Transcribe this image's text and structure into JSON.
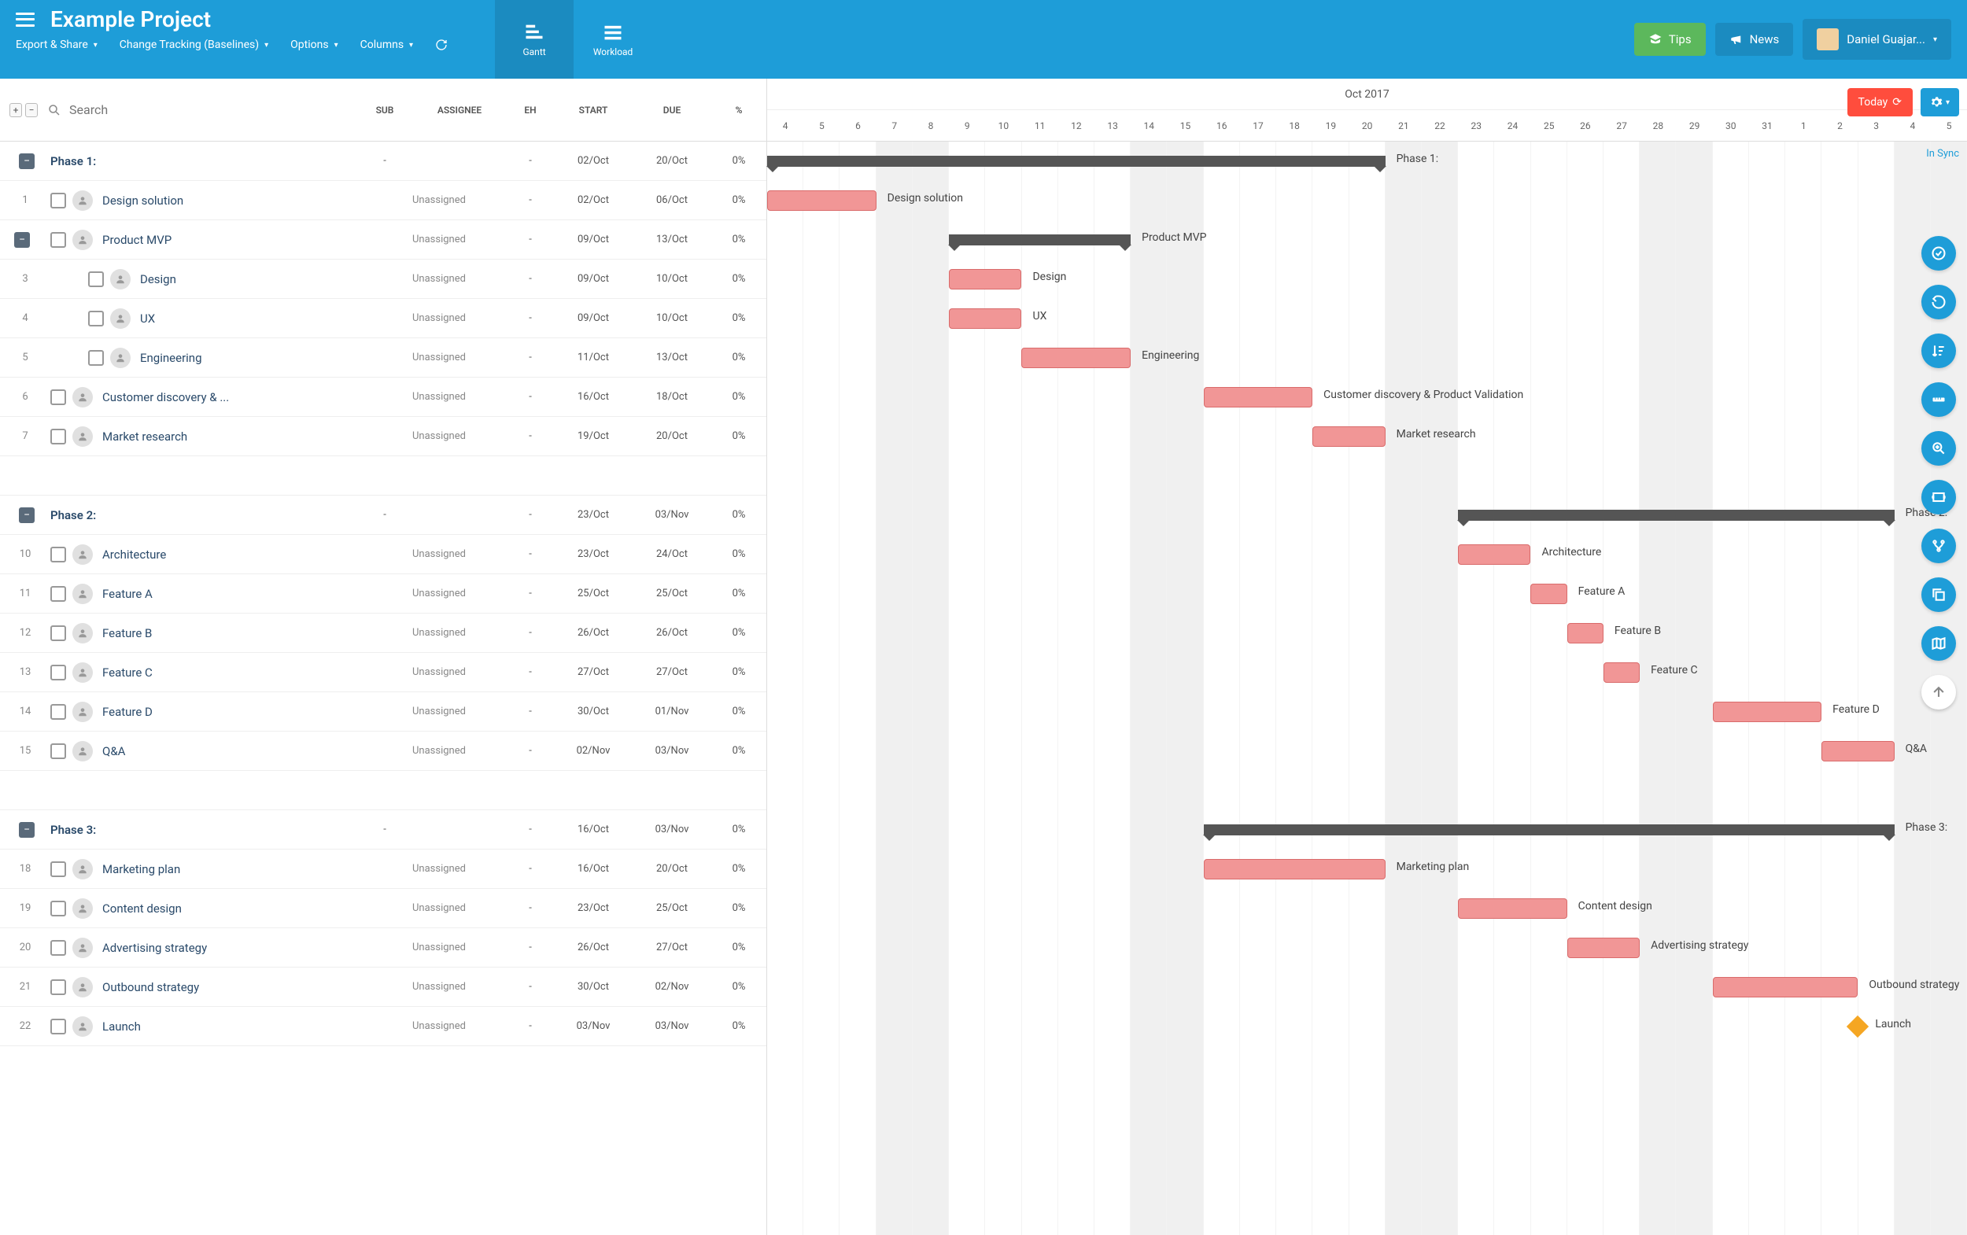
{
  "project_title": "Example Project",
  "top_menu": {
    "export": "Export & Share",
    "tracking": "Change Tracking (Baselines)",
    "options": "Options",
    "columns": "Columns"
  },
  "views": {
    "gantt": "Gantt",
    "workload": "Workload"
  },
  "top_buttons": {
    "tips": "Tips",
    "news": "News",
    "user": "Daniel Guajar..."
  },
  "search_placeholder": "Search",
  "col_headers": {
    "sub": "SUB",
    "assignee": "ASSIGNEE",
    "eh": "EH",
    "start": "START",
    "due": "DUE",
    "pct": "%"
  },
  "month_label": "Oct 2017",
  "days": [
    "4",
    "5",
    "6",
    "7",
    "8",
    "9",
    "10",
    "11",
    "12",
    "13",
    "14",
    "15",
    "16",
    "17",
    "18",
    "19",
    "20",
    "21",
    "22",
    "23",
    "24",
    "25",
    "26",
    "27",
    "28",
    "29",
    "30",
    "31",
    "1",
    "2",
    "3",
    "4",
    "5"
  ],
  "today_label": "Today",
  "sync_label": "In Sync",
  "phases": [
    {
      "name": "Phase 1:",
      "sub": "-",
      "eh": "-",
      "start": "02/Oct",
      "due": "20/Oct",
      "pct": "0%",
      "bar_start": 0,
      "bar_span": 17,
      "label": "Phase 1:"
    },
    {
      "name": "Phase 2:",
      "sub": "-",
      "eh": "-",
      "start": "23/Oct",
      "due": "03/Nov",
      "pct": "0%",
      "bar_start": 19,
      "bar_span": 12,
      "label": "Phase 2:"
    },
    {
      "name": "Phase 3:",
      "sub": "-",
      "eh": "-",
      "start": "16/Oct",
      "due": "03/Nov",
      "pct": "0%",
      "bar_start": 12,
      "bar_span": 19,
      "label": "Phase 3:"
    }
  ],
  "tasks": [
    {
      "num": "1",
      "name": "Design solution",
      "assignee": "Unassigned",
      "eh": "-",
      "start": "02/Oct",
      "due": "06/Oct",
      "pct": "0%",
      "indent": 1,
      "bar_start": 0,
      "bar_span": 3,
      "label": "Design solution"
    },
    {
      "num": "",
      "name": "Product MVP",
      "assignee": "Unassigned",
      "eh": "-",
      "start": "09/Oct",
      "due": "13/Oct",
      "pct": "0%",
      "indent": 1,
      "summary": true,
      "bar_start": 5,
      "bar_span": 5,
      "label": "Product MVP",
      "collapse": true
    },
    {
      "num": "3",
      "name": "Design",
      "assignee": "Unassigned",
      "eh": "-",
      "start": "09/Oct",
      "due": "10/Oct",
      "pct": "0%",
      "indent": 2,
      "bar_start": 5,
      "bar_span": 2,
      "label": "Design"
    },
    {
      "num": "4",
      "name": "UX",
      "assignee": "Unassigned",
      "eh": "-",
      "start": "09/Oct",
      "due": "10/Oct",
      "pct": "0%",
      "indent": 2,
      "bar_start": 5,
      "bar_span": 2,
      "label": "UX"
    },
    {
      "num": "5",
      "name": "Engineering",
      "assignee": "Unassigned",
      "eh": "-",
      "start": "11/Oct",
      "due": "13/Oct",
      "pct": "0%",
      "indent": 2,
      "bar_start": 7,
      "bar_span": 3,
      "label": "Engineering"
    },
    {
      "num": "6",
      "name": "Customer discovery & ...",
      "assignee": "Unassigned",
      "eh": "-",
      "start": "16/Oct",
      "due": "18/Oct",
      "pct": "0%",
      "indent": 1,
      "bar_start": 12,
      "bar_span": 3,
      "label": "Customer discovery & Product Validation"
    },
    {
      "num": "7",
      "name": "Market research",
      "assignee": "Unassigned",
      "eh": "-",
      "start": "19/Oct",
      "due": "20/Oct",
      "pct": "0%",
      "indent": 1,
      "bar_start": 15,
      "bar_span": 2,
      "label": "Market research"
    },
    {
      "num": "10",
      "name": "Architecture",
      "assignee": "Unassigned",
      "eh": "-",
      "start": "23/Oct",
      "due": "24/Oct",
      "pct": "0%",
      "indent": 1,
      "bar_start": 19,
      "bar_span": 2,
      "label": "Architecture"
    },
    {
      "num": "11",
      "name": "Feature A",
      "assignee": "Unassigned",
      "eh": "-",
      "start": "25/Oct",
      "due": "25/Oct",
      "pct": "0%",
      "indent": 1,
      "bar_start": 21,
      "bar_span": 1,
      "label": "Feature A"
    },
    {
      "num": "12",
      "name": "Feature B",
      "assignee": "Unassigned",
      "eh": "-",
      "start": "26/Oct",
      "due": "26/Oct",
      "pct": "0%",
      "indent": 1,
      "bar_start": 22,
      "bar_span": 1,
      "label": "Feature B"
    },
    {
      "num": "13",
      "name": "Feature C",
      "assignee": "Unassigned",
      "eh": "-",
      "start": "27/Oct",
      "due": "27/Oct",
      "pct": "0%",
      "indent": 1,
      "bar_start": 23,
      "bar_span": 1,
      "label": "Feature C"
    },
    {
      "num": "14",
      "name": "Feature D",
      "assignee": "Unassigned",
      "eh": "-",
      "start": "30/Oct",
      "due": "01/Nov",
      "pct": "0%",
      "indent": 1,
      "bar_start": 26,
      "bar_span": 3,
      "label": "Feature D"
    },
    {
      "num": "15",
      "name": "Q&A",
      "assignee": "Unassigned",
      "eh": "-",
      "start": "02/Nov",
      "due": "03/Nov",
      "pct": "0%",
      "indent": 1,
      "bar_start": 29,
      "bar_span": 2,
      "label": "Q&A"
    },
    {
      "num": "18",
      "name": "Marketing plan",
      "assignee": "Unassigned",
      "eh": "-",
      "start": "16/Oct",
      "due": "20/Oct",
      "pct": "0%",
      "indent": 1,
      "bar_start": 12,
      "bar_span": 5,
      "label": "Marketing plan"
    },
    {
      "num": "19",
      "name": "Content design",
      "assignee": "Unassigned",
      "eh": "-",
      "start": "23/Oct",
      "due": "25/Oct",
      "pct": "0%",
      "indent": 1,
      "bar_start": 19,
      "bar_span": 3,
      "label": "Content design"
    },
    {
      "num": "20",
      "name": "Advertising strategy",
      "assignee": "Unassigned",
      "eh": "-",
      "start": "26/Oct",
      "due": "27/Oct",
      "pct": "0%",
      "indent": 1,
      "bar_start": 22,
      "bar_span": 2,
      "label": "Advertising strategy"
    },
    {
      "num": "21",
      "name": "Outbound strategy",
      "assignee": "Unassigned",
      "eh": "-",
      "start": "30/Oct",
      "due": "02/Nov",
      "pct": "0%",
      "indent": 1,
      "bar_start": 26,
      "bar_span": 4,
      "label": "Outbound strategy"
    },
    {
      "num": "22",
      "name": "Launch",
      "assignee": "Unassigned",
      "eh": "-",
      "start": "03/Nov",
      "due": "03/Nov",
      "pct": "0%",
      "indent": 1,
      "milestone": true,
      "bar_start": 30,
      "bar_span": 0,
      "label": "Launch"
    }
  ],
  "chart_data": {
    "type": "gantt",
    "title": "Example Project",
    "date_range": {
      "start": "2017-10-04",
      "end": "2017-11-05"
    },
    "phases": [
      {
        "name": "Phase 1",
        "start": "2017-10-02",
        "end": "2017-10-20"
      },
      {
        "name": "Phase 2",
        "start": "2017-10-23",
        "end": "2017-11-03"
      },
      {
        "name": "Phase 3",
        "start": "2017-10-16",
        "end": "2017-11-03"
      }
    ],
    "tasks": [
      {
        "phase": "Phase 1",
        "name": "Design solution",
        "start": "2017-10-02",
        "end": "2017-10-06",
        "pct": 0
      },
      {
        "phase": "Phase 1",
        "name": "Product MVP",
        "start": "2017-10-09",
        "end": "2017-10-13",
        "pct": 0,
        "summary": true
      },
      {
        "phase": "Phase 1",
        "name": "Design",
        "start": "2017-10-09",
        "end": "2017-10-10",
        "pct": 0,
        "parent": "Product MVP"
      },
      {
        "phase": "Phase 1",
        "name": "UX",
        "start": "2017-10-09",
        "end": "2017-10-10",
        "pct": 0,
        "parent": "Product MVP"
      },
      {
        "phase": "Phase 1",
        "name": "Engineering",
        "start": "2017-10-11",
        "end": "2017-10-13",
        "pct": 0,
        "parent": "Product MVP"
      },
      {
        "phase": "Phase 1",
        "name": "Customer discovery & Product Validation",
        "start": "2017-10-16",
        "end": "2017-10-18",
        "pct": 0
      },
      {
        "phase": "Phase 1",
        "name": "Market research",
        "start": "2017-10-19",
        "end": "2017-10-20",
        "pct": 0
      },
      {
        "phase": "Phase 2",
        "name": "Architecture",
        "start": "2017-10-23",
        "end": "2017-10-24",
        "pct": 0
      },
      {
        "phase": "Phase 2",
        "name": "Feature A",
        "start": "2017-10-25",
        "end": "2017-10-25",
        "pct": 0
      },
      {
        "phase": "Phase 2",
        "name": "Feature B",
        "start": "2017-10-26",
        "end": "2017-10-26",
        "pct": 0
      },
      {
        "phase": "Phase 2",
        "name": "Feature C",
        "start": "2017-10-27",
        "end": "2017-10-27",
        "pct": 0
      },
      {
        "phase": "Phase 2",
        "name": "Feature D",
        "start": "2017-10-30",
        "end": "2017-11-01",
        "pct": 0
      },
      {
        "phase": "Phase 2",
        "name": "Q&A",
        "start": "2017-11-02",
        "end": "2017-11-03",
        "pct": 0
      },
      {
        "phase": "Phase 3",
        "name": "Marketing plan",
        "start": "2017-10-16",
        "end": "2017-10-20",
        "pct": 0
      },
      {
        "phase": "Phase 3",
        "name": "Content design",
        "start": "2017-10-23",
        "end": "2017-10-25",
        "pct": 0
      },
      {
        "phase": "Phase 3",
        "name": "Advertising strategy",
        "start": "2017-10-26",
        "end": "2017-10-27",
        "pct": 0
      },
      {
        "phase": "Phase 3",
        "name": "Outbound strategy",
        "start": "2017-10-30",
        "end": "2017-11-02",
        "pct": 0
      },
      {
        "phase": "Phase 3",
        "name": "Launch",
        "start": "2017-11-03",
        "end": "2017-11-03",
        "pct": 0,
        "milestone": true
      }
    ]
  }
}
